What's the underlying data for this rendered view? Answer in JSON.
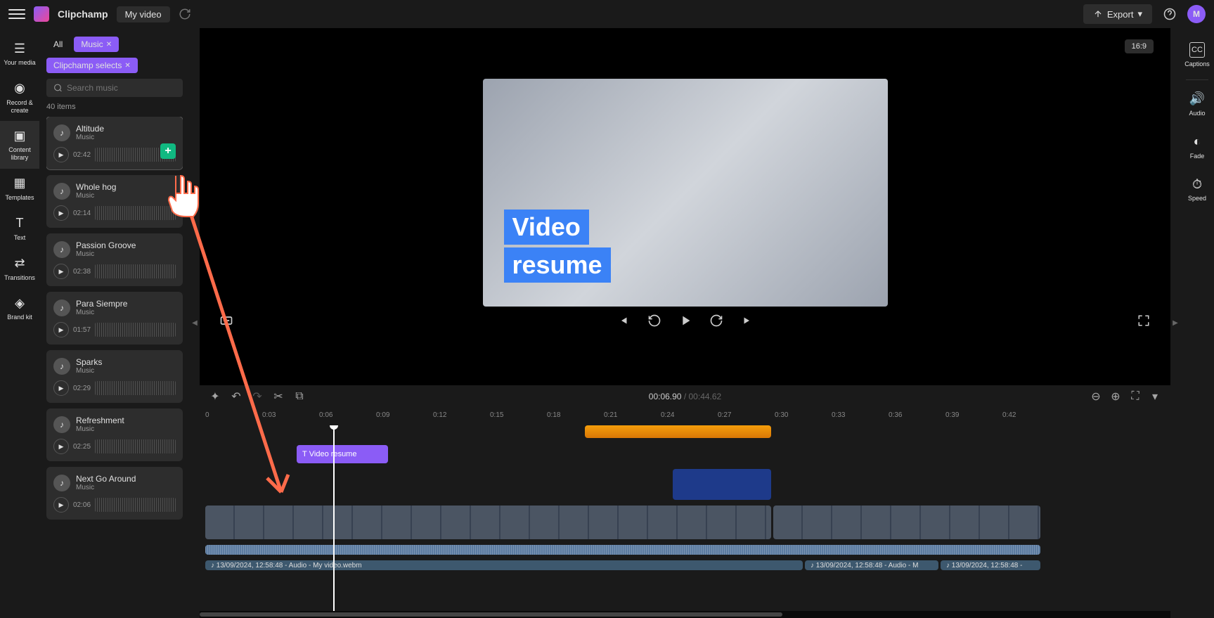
{
  "header": {
    "app_name": "Clipchamp",
    "project_name": "My video",
    "export_label": "Export",
    "avatar_initial": "M"
  },
  "left_nav": [
    {
      "label": "Your media",
      "icon": "📁"
    },
    {
      "label": "Record & create",
      "icon": "⏺"
    },
    {
      "label": "Content library",
      "icon": "📚"
    },
    {
      "label": "Templates",
      "icon": "▦"
    },
    {
      "label": "Text",
      "icon": "T"
    },
    {
      "label": "Transitions",
      "icon": "⇄"
    },
    {
      "label": "Brand kit",
      "icon": "🎨"
    }
  ],
  "media_panel": {
    "chip_all": "All",
    "chip_music": "Music",
    "chip_selects": "Clipchamp selects",
    "search_placeholder": "Search music",
    "item_count": "40 items",
    "add_tooltip": "Add to timeline",
    "items": [
      {
        "title": "Altitude",
        "sub": "Music",
        "duration": "02:42",
        "highlighted": true
      },
      {
        "title": "Whole hog",
        "sub": "Music",
        "duration": "02:14"
      },
      {
        "title": "Passion Groove",
        "sub": "Music",
        "duration": "02:38"
      },
      {
        "title": "Para Siempre",
        "sub": "Music",
        "duration": "01:57"
      },
      {
        "title": "Sparks",
        "sub": "Music",
        "duration": "02:29"
      },
      {
        "title": "Refreshment",
        "sub": "Music",
        "duration": "02:25"
      },
      {
        "title": "Next Go Around",
        "sub": "Music",
        "duration": "02:06"
      }
    ]
  },
  "preview": {
    "aspect": "16:9",
    "text_line1": "Video",
    "text_line2": "resume"
  },
  "toolbar": {
    "time_current": "00:06.90",
    "time_sep": " / ",
    "time_total": "00:44.62"
  },
  "ruler_marks": [
    "0",
    "0:03",
    "0:06",
    "0:09",
    "0:12",
    "0:15",
    "0:18",
    "0:21",
    "0:24",
    "0:27",
    "0:30",
    "0:33",
    "0:36",
    "0:39",
    "0:42"
  ],
  "timeline": {
    "text_clip": "Video resume",
    "audio_clip1": "13/09/2024, 12:58:48 - Audio - My video.webm",
    "audio_clip2": "13/09/2024, 12:58:48 - Audio - M",
    "audio_clip3": "13/09/2024, 12:58:48 -"
  },
  "right_panel": [
    {
      "label": "Captions",
      "icon": "CC"
    },
    {
      "label": "Audio",
      "icon": "🔊"
    },
    {
      "label": "Fade",
      "icon": "◐"
    },
    {
      "label": "Speed",
      "icon": "⏱"
    }
  ]
}
